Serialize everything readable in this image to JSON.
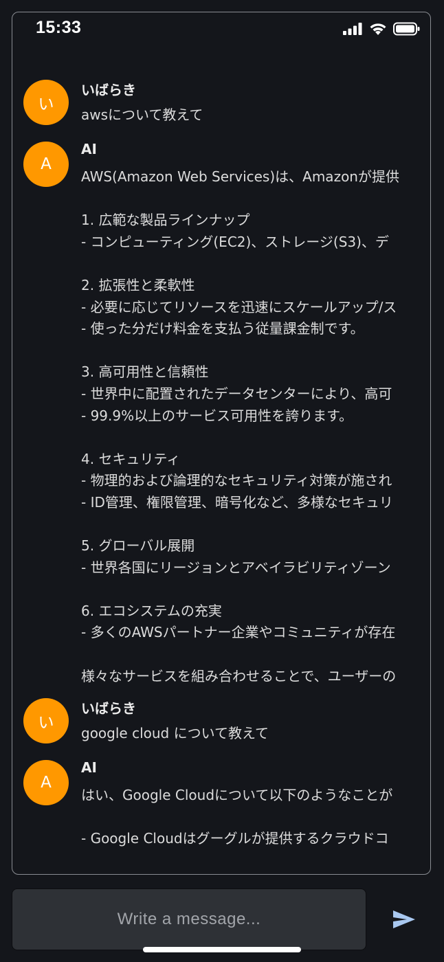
{
  "status_bar": {
    "time": "15:33",
    "icons": [
      "cellular-signal-icon",
      "wifi-icon",
      "battery-icon"
    ]
  },
  "colors": {
    "background": "#14161b",
    "avatar": "#ff9800",
    "send_icon": "#a9c8f0",
    "input_bg": "#2e3136"
  },
  "messages": [
    {
      "sender": "いばらき",
      "avatar_initial": "い",
      "text": "awsについて教えて"
    },
    {
      "sender": "AI",
      "avatar_initial": "A",
      "text": "AWS(Amazon Web Services)は、Amazonが提供\n\n1. 広範な製品ラインナップ\n- コンピューティング(EC2)、ストレージ(S3)、デ\n\n2. 拡張性と柔軟性\n- 必要に応じてリソースを迅速にスケールアップ/ス\n- 使った分だけ料金を支払う従量課金制です。\n\n3. 高可用性と信頼性\n- 世界中に配置されたデータセンターにより、高可\n- 99.9%以上のサービス可用性を誇ります。\n\n4. セキュリティ\n- 物理的および論理的なセキュリティ対策が施され\n- ID管理、権限管理、暗号化など、多様なセキュリ\n\n5. グローバル展開\n- 世界各国にリージョンとアベイラビリティゾーン\n\n6. エコシステムの充実\n- 多くのAWSパートナー企業やコミュニティが存在\n\n様々なサービスを組み合わせることで、ユーザーの"
    },
    {
      "sender": "いばらき",
      "avatar_initial": "い",
      "text": "google cloud について教えて"
    },
    {
      "sender": "AI",
      "avatar_initial": "A",
      "text": "はい、Google Cloudについて以下のようなことが\n\n- Google Cloudはグーグルが提供するクラウドコ"
    }
  ],
  "composer": {
    "placeholder": "Write a message...",
    "send_icon": "send-icon"
  }
}
